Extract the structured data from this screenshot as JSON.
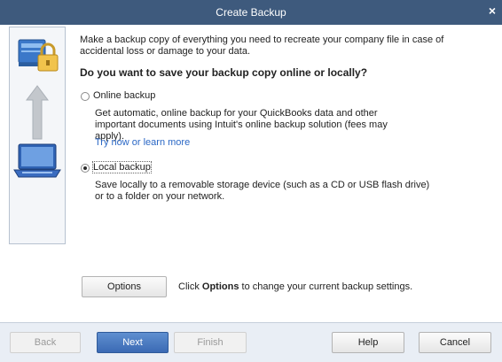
{
  "window": {
    "title": "Create Backup",
    "close_label": "×"
  },
  "intro": "Make a backup copy of everything you need to recreate your company file in case of accidental loss or damage to your data.",
  "question": "Do you want to save your backup copy online or locally?",
  "options": {
    "online": {
      "label": "Online backup",
      "selected": false,
      "description": "Get automatic, online backup for your QuickBooks data and other important documents using Intuit's online backup solution (fees may apply).",
      "link": "Try now or learn more"
    },
    "local": {
      "label": "Local backup",
      "selected": true,
      "description": "Save locally to a removable storage device (such as a CD or USB flash drive) or to a folder on your network."
    }
  },
  "options_button": {
    "label": "Options",
    "help_prefix": "Click ",
    "help_bold": "Options",
    "help_suffix": " to change your current backup settings."
  },
  "footer": {
    "back": "Back",
    "next": "Next",
    "finish": "Finish",
    "help": "Help",
    "cancel": "Cancel"
  },
  "colors": {
    "titlebar": "#3e5a7d",
    "primary_button": "#3b6ab4",
    "link": "#2a67c5"
  },
  "icons": [
    "server-icon",
    "lock-icon",
    "up-arrow-icon",
    "laptop-icon"
  ]
}
